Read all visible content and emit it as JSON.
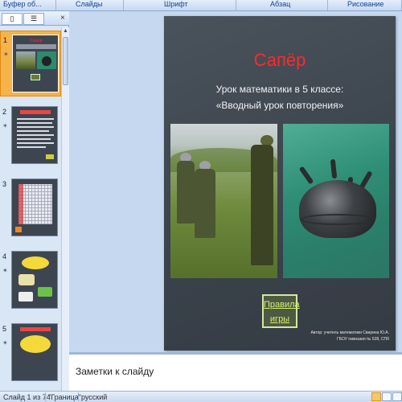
{
  "ribbon": {
    "groups": [
      "Буфер об...",
      "Слайды",
      "Шрифт",
      "Абзац",
      "Рисование"
    ]
  },
  "left_pane": {
    "tab_slides_icon": "slides-icon",
    "tab_outline_icon": "outline-icon",
    "close": "×",
    "slides": [
      {
        "number": "1",
        "selected": true
      },
      {
        "number": "2",
        "selected": false
      },
      {
        "number": "3",
        "selected": false
      },
      {
        "number": "4",
        "selected": false
      },
      {
        "number": "5",
        "selected": false
      }
    ]
  },
  "slide": {
    "title": "Сапёр",
    "subtitle_line1": "Урок математики в 5 классе:",
    "subtitle_line2": "«Вводный урок повторения»",
    "rules_button_line1": "Правила",
    "rules_button_line2": "игры",
    "author_line1": "Автор: учитель математики Свирина Ю.А.",
    "author_line2": "ГБОУ гимназия № 528, СПб"
  },
  "notes": {
    "placeholder": "Заметки к слайду"
  },
  "status_bar": {
    "slide_counter": "Слайд 1 из 74",
    "theme": "\"Граница\"",
    "language": "русский"
  },
  "colors": {
    "slide_background": "#3d454e",
    "title_red": "#ff2a2a",
    "selection_orange": "#f5b34a"
  }
}
